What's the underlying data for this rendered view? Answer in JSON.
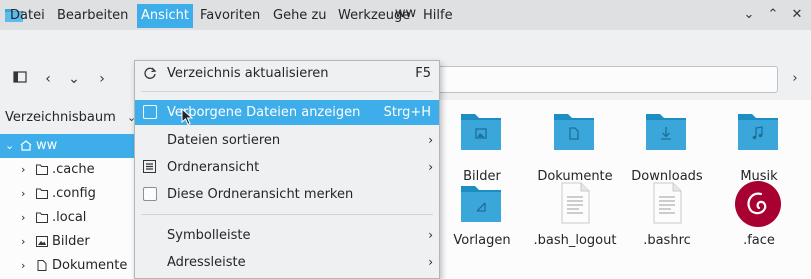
{
  "window": {
    "title": "ww",
    "controls": [
      "chevron-down-icon",
      "chevron-up-icon",
      "close-icon"
    ]
  },
  "menubar": {
    "items": [
      {
        "label": "Datei"
      },
      {
        "label": "Bearbeiten"
      },
      {
        "label": "Ansicht",
        "active": true
      },
      {
        "label": "Favoriten"
      },
      {
        "label": "Gehe zu"
      },
      {
        "label": "Werkzeuge"
      },
      {
        "label": "Hilfe"
      }
    ]
  },
  "toolbar": {
    "icons": [
      "panel-icon",
      "back-icon",
      "down-icon",
      "forward-icon"
    ],
    "location_value": "",
    "more_icon": "chevron-right-icon"
  },
  "tree": {
    "header": "Verzeichnisbaum",
    "rows": [
      {
        "label": "ww",
        "icon": "home-icon",
        "selected": true,
        "expanded": true
      },
      {
        "label": ".cache",
        "icon": "folder-icon"
      },
      {
        "label": ".config",
        "icon": "folder-icon"
      },
      {
        "label": ".local",
        "icon": "folder-icon"
      },
      {
        "label": "Bilder",
        "icon": "pictures-icon"
      },
      {
        "label": "Dokumente",
        "icon": "document-icon"
      }
    ]
  },
  "files": [
    {
      "label": "Bilder",
      "icon": "pictures-folder-icon"
    },
    {
      "label": "Dokumente",
      "icon": "documents-folder-icon"
    },
    {
      "label": "Downloads",
      "icon": "downloads-folder-icon"
    },
    {
      "label": "Musik",
      "icon": "music-folder-icon"
    },
    {
      "label": "Vorlagen",
      "icon": "templates-folder-icon"
    },
    {
      "label": ".bash_logout",
      "icon": "text-file-icon"
    },
    {
      "label": ".bashrc",
      "icon": "text-file-icon"
    },
    {
      "label": ".face",
      "icon": "debian-logo-icon"
    }
  ],
  "dropdown": {
    "items": [
      {
        "label": "Verzeichnis aktualisieren",
        "shortcut": "F5",
        "icon": "refresh-icon"
      },
      {
        "label": "Verborgene Dateien anzeigen",
        "shortcut": "Strg+H",
        "checkbox": true,
        "highlighted": true
      },
      {
        "label": "Dateien sortieren",
        "submenu": true
      },
      {
        "label": "Ordneransicht",
        "submenu": true,
        "icon": "list-view-icon"
      },
      {
        "label": "Diese Ordneransicht merken",
        "checkbox": true
      },
      {
        "label": "Symbolleiste",
        "submenu": true
      },
      {
        "label": "Adressleiste",
        "submenu": true
      }
    ]
  },
  "colors": {
    "accent": "#3daee9",
    "folder": "#3aa6d9",
    "debian": "#a80030"
  }
}
